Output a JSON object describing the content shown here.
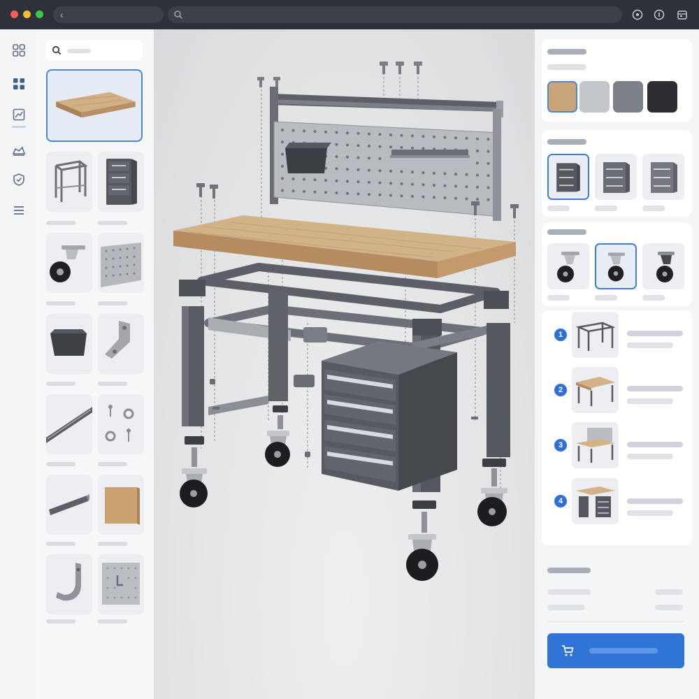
{
  "window": {
    "controls": [
      "close",
      "minimize",
      "zoom"
    ],
    "icons": [
      "chevron-left-icon",
      "search-icon",
      "shield-icon",
      "info-icon",
      "calendar-icon"
    ]
  },
  "rail": {
    "items": [
      "components-grid-icon",
      "layout-grid-icon",
      "measure-icon",
      "material-icon",
      "shield-check-icon",
      "menu-icon"
    ],
    "active": "layout-grid-icon"
  },
  "parts_library": {
    "featured": "wood-top",
    "items": [
      "frame",
      "drawer-cabinet",
      "caster",
      "pegboard",
      "bin",
      "bracket",
      "rail",
      "hardware",
      "crossbar",
      "wood-panel",
      "hook",
      "pegboard-hooks"
    ]
  },
  "configurator": {
    "finish_swatches": [
      {
        "name": "oak",
        "color": "#c9a67a"
      },
      {
        "name": "brushed-steel",
        "color": "#c3c6ca"
      },
      {
        "name": "graphite",
        "color": "#7d8086"
      },
      {
        "name": "black",
        "color": "#2c2e33"
      }
    ],
    "cabinet_selected": 0,
    "caster_selected": 1,
    "steps": [
      "1",
      "2",
      "3",
      "4"
    ]
  },
  "colors": {
    "accent": "#2f74d6",
    "selection": "#4a87d6",
    "steel": "#5c5f65"
  }
}
